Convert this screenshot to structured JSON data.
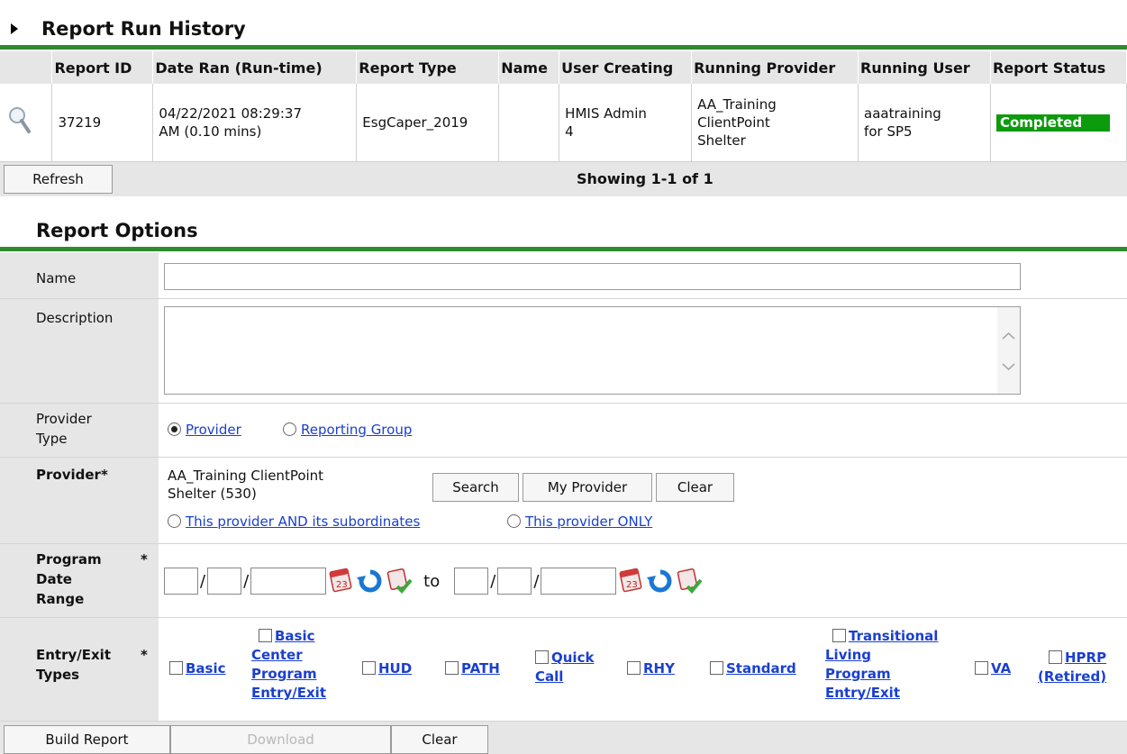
{
  "history": {
    "title": "Report Run History",
    "columns": [
      "Report ID",
      "Date Ran (Run-time)",
      "Report Type",
      "Name",
      "User Creating",
      "Running Provider",
      "Running User",
      "Report Status"
    ],
    "rows": [
      {
        "report_id": "37219",
        "date_ran_1": "04/22/2021 08:29:37",
        "date_ran_2": "AM (0.10 mins)",
        "report_type": "EsgCaper_2019",
        "name": "",
        "user_creating_1": "HMIS Admin",
        "user_creating_2": "4",
        "running_provider_1": "AA_Training",
        "running_provider_2": "ClientPoint",
        "running_provider_3": "Shelter",
        "running_user_1": "aaatraining",
        "running_user_2": "for SP5",
        "status": "Completed"
      }
    ],
    "refresh_label": "Refresh",
    "showing": "Showing 1-1 of 1"
  },
  "options": {
    "title": "Report Options",
    "name_label": "Name",
    "name_value": "",
    "description_label": "Description",
    "description_value": "",
    "provider_type_label_1": "Provider",
    "provider_type_label_2": "Type",
    "provider_type_options": [
      "Provider",
      "Reporting Group"
    ],
    "provider_label": "Provider",
    "provider_value_1": "AA_Training ClientPoint",
    "provider_value_2": "Shelter (530)",
    "search_label": "Search",
    "my_provider_label": "My Provider",
    "clear_label": "Clear",
    "scope_options": [
      "This provider AND its subordinates",
      "This provider ONLY"
    ],
    "date_range_label_1": "Program",
    "date_range_label_2": "Date",
    "date_range_label_3": "Range",
    "to_label": "to",
    "entry_exit_label_1": "Entry/Exit",
    "entry_exit_label_2": "Types",
    "entry_exit_types": {
      "basic": "Basic",
      "basic_center_1": "Basic",
      "basic_center_2": "Center",
      "basic_center_3": "Program",
      "basic_center_4": "Entry/Exit",
      "hud": "HUD",
      "path": "PATH",
      "quick_call_1": "Quick",
      "quick_call_2": "Call",
      "rhy": "RHY",
      "standard": "Standard",
      "tlp_1": "Transitional",
      "tlp_2": "Living",
      "tlp_3": "Program",
      "tlp_4": "Entry/Exit",
      "va": "VA",
      "hprp_1": "HPRP",
      "hprp_2": "(Retired)"
    },
    "required_mark": "*"
  },
  "footer": {
    "build_label": "Build Report",
    "download_label": "Download",
    "clear_label": "Clear"
  },
  "colors": {
    "accent_green": "#2e8b2e",
    "status_green": "#0c9b0c",
    "link_blue": "#1a3fd1",
    "panel_gray": "#e6e6e6"
  }
}
